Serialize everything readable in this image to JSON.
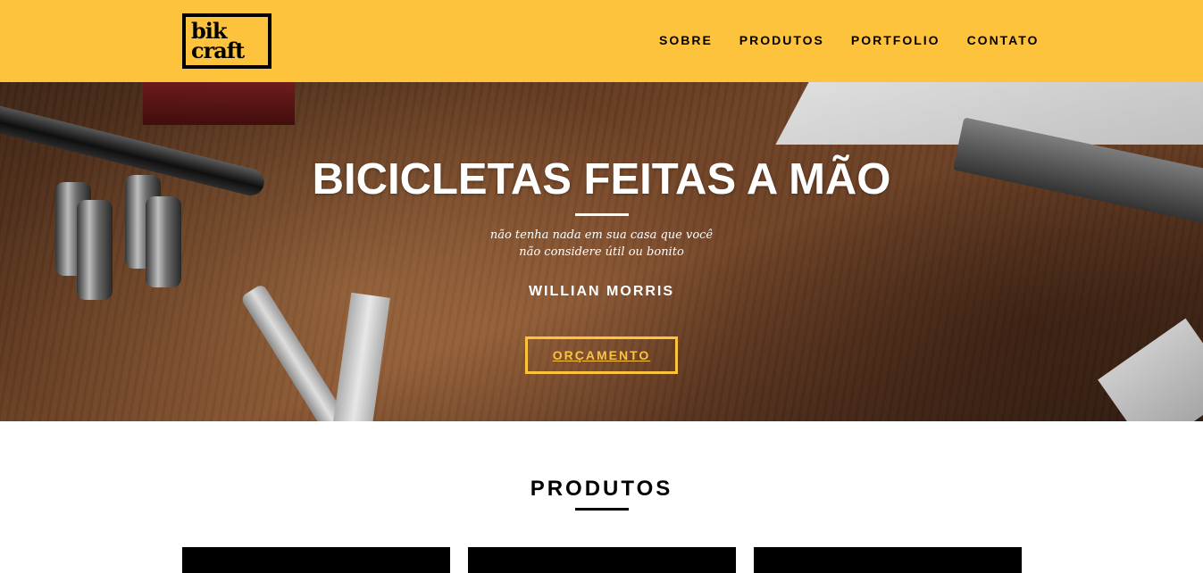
{
  "header": {
    "logo_line1": "bik",
    "logo_line2": "craft",
    "nav": [
      {
        "label": "SOBRE"
      },
      {
        "label": "PRODUTOS"
      },
      {
        "label": "PORTFOLIO"
      },
      {
        "label": "CONTATO"
      }
    ]
  },
  "hero": {
    "title": "BICICLETAS FEITAS A MÃO",
    "quote_line1": "não tenha nada em sua casa que você",
    "quote_line2": "não considere útil ou bonito",
    "author": "WILLIAN MORRIS",
    "cta_label": "ORÇAMENTO"
  },
  "produtos": {
    "title": "PRODUTOS"
  },
  "colors": {
    "accent": "#fec33c",
    "text": "#000000",
    "hero_text": "#ffffff"
  }
}
